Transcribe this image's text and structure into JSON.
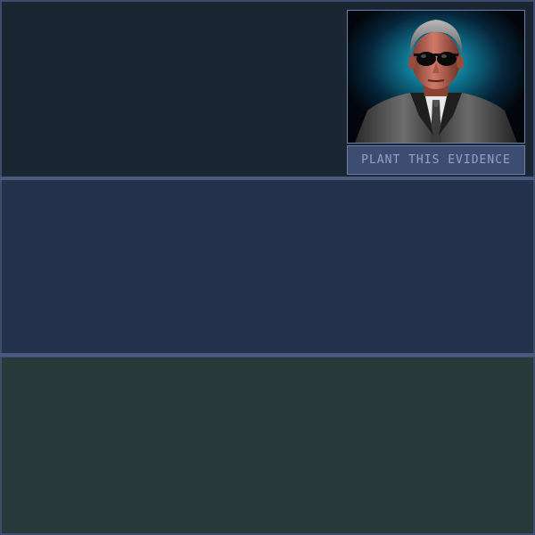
{
  "top_panel": {
    "portrait": {
      "icon": "agent-portrait-icon"
    },
    "plant_button_label": "PLANT THIS EVIDENCE"
  },
  "colors": {
    "frame": "#3e4d6e",
    "top_panel_bg": "#1a2632",
    "middle_panel_bg": "#24324c",
    "bottom_panel_bg": "#29393a",
    "button_bg": "#3d4d72",
    "button_text": "#8fa3cf",
    "portrait_glow": "#1aa8c0"
  }
}
